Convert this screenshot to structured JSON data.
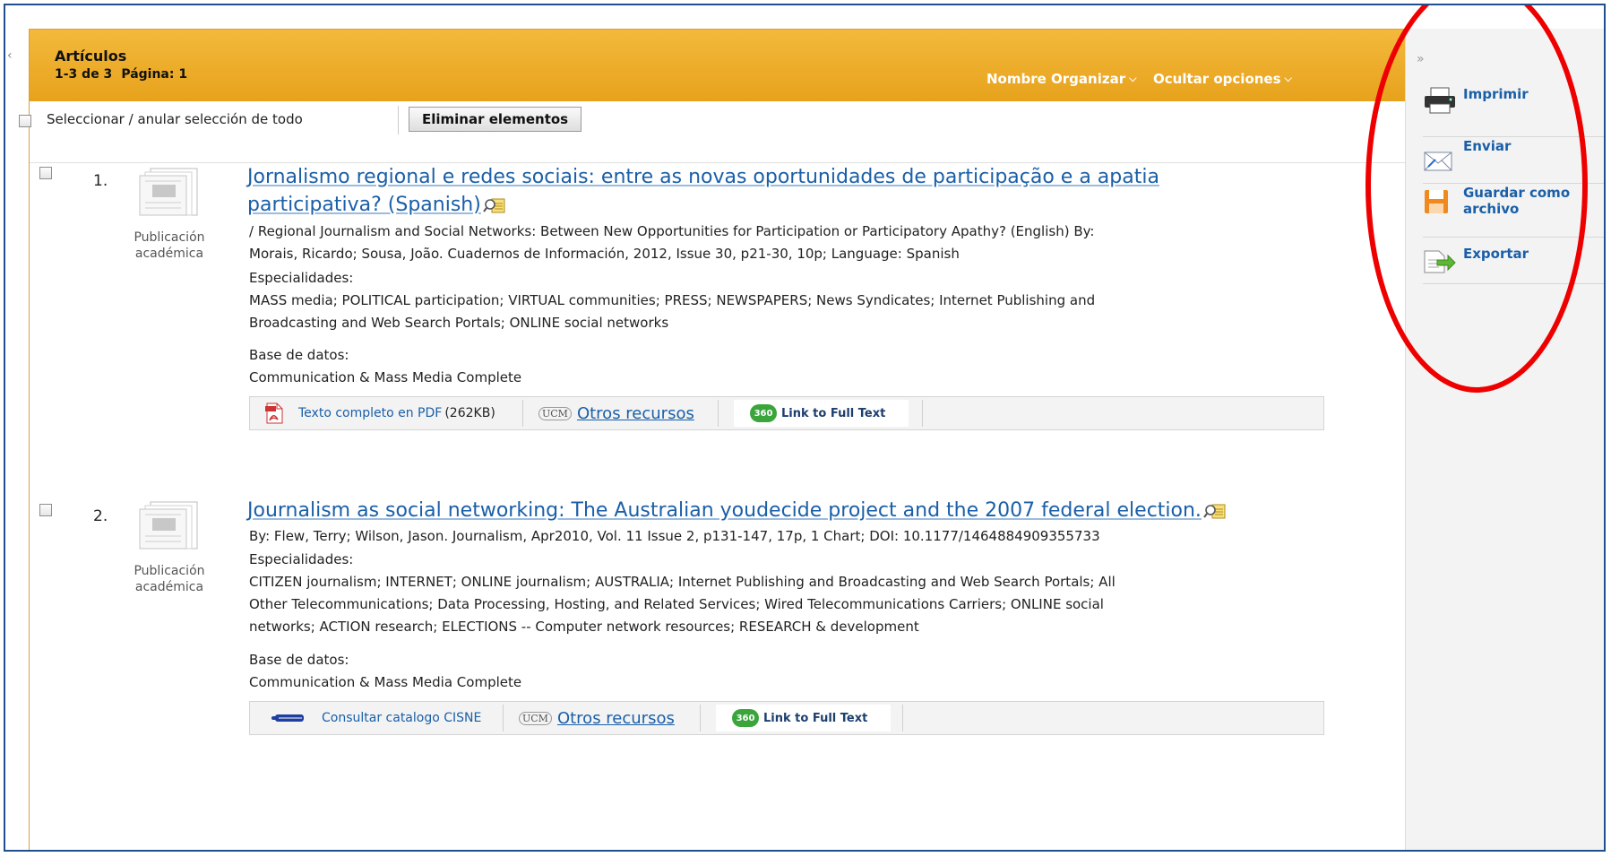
{
  "header": {
    "title": "Artículos",
    "range": "1-3 de 3",
    "page": "Página: 1",
    "sort_label": "Nombre Organizar",
    "options_label": "Ocultar opciones"
  },
  "toolbar": {
    "select_all_label": "Seleccionar / anular selección de todo",
    "delete_button": "Eliminar elementos"
  },
  "results": [
    {
      "number": "1.",
      "type_label_1": "Publicación",
      "type_label_2": "académica",
      "title_line1": "Jornalismo regional e redes sociais: entre as novas oportunidades de participação e a apatia",
      "title_line2": "participativa? (Spanish)",
      "citation_line1": "/ Regional Journalism and Social Networks: Between New Opportunities for Participation or Participatory Apathy? (English) By:",
      "citation_line2": "Morais, Ricardo; Sousa, João. Cuadernos de Información, 2012, Issue 30, p21-30, 10p; Language: Spanish",
      "subjects_label": "Especialidades:",
      "subjects_line1": "MASS media; POLITICAL participation; VIRTUAL communities; PRESS; NEWSPAPERS; News Syndicates; Internet Publishing and",
      "subjects_line2": "Broadcasting and Web Search Portals; ONLINE social networks",
      "database_label": "Base de datos:",
      "database": "Communication & Mass Media Complete",
      "link_pdf": "Texto completo en PDF",
      "pdf_size": "(262KB)",
      "link_other": "Otros recursos",
      "link_360": "Link to Full Text"
    },
    {
      "number": "2.",
      "type_label_1": "Publicación",
      "type_label_2": "académica",
      "title_line1": "Journalism as social networking: The Australian youdecide project and the 2007 federal election.",
      "citation_line1": "By: Flew, Terry; Wilson, Jason. Journalism, Apr2010, Vol. 11 Issue 2, p131-147, 17p, 1 Chart; DOI: 10.1177/1464884909355733",
      "subjects_label": "Especialidades:",
      "subjects_line1": "CITIZEN journalism; INTERNET; ONLINE journalism; AUSTRALIA; Internet Publishing and Broadcasting and Web Search Portals; All",
      "subjects_line2": "Other Telecommunications; Data Processing, Hosting, and Related Services; Wired Telecommunications Carriers; ONLINE social",
      "subjects_line3": "networks; ACTION research; ELECTIONS -- Computer network resources; RESEARCH & development",
      "database_label": "Base de datos:",
      "database": "Communication & Mass Media Complete",
      "link_catalog": "Consultar catalogo CISNE",
      "link_other": "Otros recursos",
      "link_360": "Link to Full Text"
    }
  ],
  "ucm_logo": "UCM",
  "badge_360": "360",
  "sidebar": {
    "print": "Imprimir",
    "email": "Enviar",
    "save_line1": "Guardar como",
    "save_line2": "archivo",
    "export": "Exportar"
  },
  "colors": {
    "header_bg": "#eaa724",
    "link": "#1a5fa8",
    "annotation_ring": "#ee0000"
  },
  "icons": [
    "printer-icon",
    "email-icon",
    "save-icon",
    "export-icon",
    "pdf-icon",
    "preview-icon",
    "document-icon",
    "catalog-icon",
    "checkbox"
  ]
}
